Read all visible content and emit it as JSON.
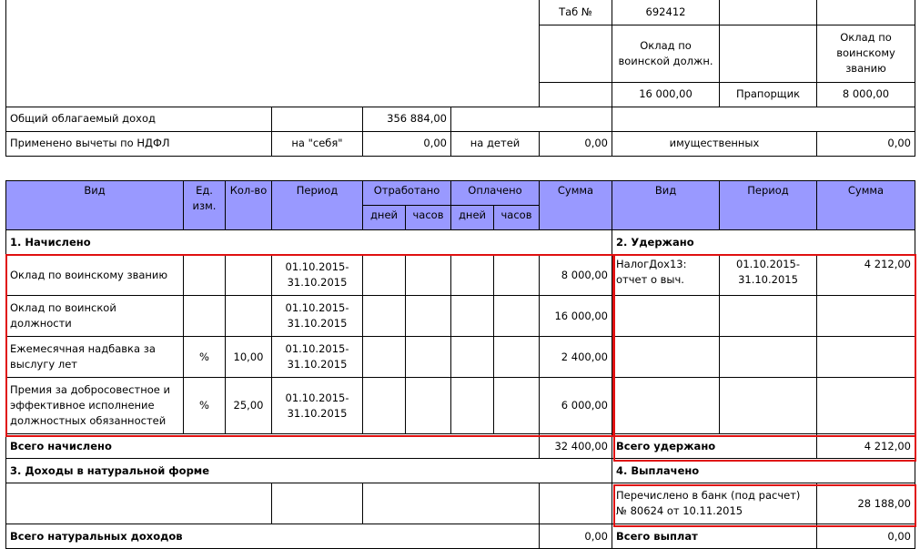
{
  "top": {
    "tab_label": "Таб №",
    "tab_value": "692412",
    "salary_position_label": "Оклад по воинской должн.",
    "salary_rank_label": "Оклад по воинскому званию",
    "salary_position_value": "16 000,00",
    "rank": "Прапорщик",
    "salary_rank_value": "8 000,00",
    "taxable_income_label": "Общий облагаемый доход",
    "taxable_income_value": "356 884,00",
    "deductions_label": "Применено вычеты по НДФЛ",
    "self_label": "на \"себя\"",
    "self_value": "0,00",
    "children_label": "на детей",
    "children_value": "0,00",
    "property_label": "имущественных",
    "property_value": "0,00"
  },
  "header": {
    "kind": "Вид",
    "unit": "Ед. изм.",
    "qty": "Кол-во",
    "period": "Период",
    "worked": "Отработано",
    "paid": "Оплачено",
    "sum": "Сумма",
    "days": "дней",
    "hours": "часов",
    "days2": "дней",
    "hours2": "часов",
    "kind_r": "Вид",
    "period_r": "Период",
    "sum_r": "Сумма"
  },
  "sections": {
    "accrued": "1. Начислено",
    "withheld": "2. Удержано",
    "natural": "3. Доходы в натуральной форме",
    "paid": "4. Выплачено"
  },
  "accruals": [
    {
      "name": "Оклад по воинскому званию",
      "unit": "",
      "qty": "",
      "period": "01.10.2015-31.10.2015",
      "sum": "8 000,00"
    },
    {
      "name": "Оклад по воинской должности",
      "unit": "",
      "qty": "",
      "period": "01.10.2015-31.10.2015",
      "sum": "16 000,00"
    },
    {
      "name": "Ежемесячная надбавка за выслугу лет",
      "unit": "%",
      "qty": "10,00",
      "period": "01.10.2015-31.10.2015",
      "sum": "2 400,00"
    },
    {
      "name": "Премия за добросовестное и эффективное исполнение должностных обязанностей",
      "unit": "%",
      "qty": "25,00",
      "period": "01.10.2015-31.10.2015",
      "sum": "6 000,00"
    }
  ],
  "withholding": {
    "name": "НалогДох13: отчет о выч.",
    "period": "01.10.2015-31.10.2015",
    "sum": "4 212,00"
  },
  "totals": {
    "accrued_label": "Всего начислено",
    "accrued_value": "32 400,00",
    "withheld_label": "Всего удержано",
    "withheld_value": "4 212,00",
    "natural_label": "Всего натуральных доходов",
    "natural_value": "0,00",
    "payments_label": "Всего выплат",
    "payments_value": "0,00"
  },
  "payment": {
    "name": "Перечислено в банк (под расчет) № 80624 от 10.11.2015",
    "sum": "28 188,00"
  },
  "colors": {
    "header_bg": "#9999ff",
    "highlight": "#e01010"
  }
}
